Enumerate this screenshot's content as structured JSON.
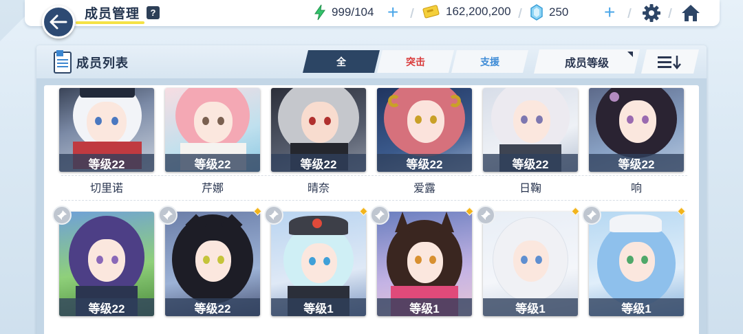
{
  "header": {
    "title": "成员管理",
    "help_label": "?",
    "stamina": "999/104",
    "gold": "162,200,200",
    "gems": "250"
  },
  "panel": {
    "title": "成员列表",
    "tabs": [
      {
        "label": "全",
        "active": true
      },
      {
        "label": "突击",
        "active": false
      },
      {
        "label": "支援",
        "active": false
      }
    ],
    "sort_label": "成员等级"
  },
  "members_row1": [
    {
      "level": "等级22",
      "name": "切里诺"
    },
    {
      "level": "等级22",
      "name": "芹娜"
    },
    {
      "level": "等级22",
      "name": "晴奈"
    },
    {
      "level": "等级22",
      "name": "爱露"
    },
    {
      "level": "等级22",
      "name": "日鞠"
    },
    {
      "level": "等级22",
      "name": "响"
    }
  ],
  "members_row2": [
    {
      "level": "等级22"
    },
    {
      "level": "等级22"
    },
    {
      "level": "等级1"
    },
    {
      "level": "等级1"
    },
    {
      "level": "等级1"
    },
    {
      "level": "等级1"
    }
  ],
  "colors": {
    "accent_dark": "#2c4564",
    "assault_red": "#d93a3a",
    "support_blue": "#3d8bd6",
    "new_dot": "#f2b41c",
    "title_underline": "#f4e246"
  },
  "icons": {
    "back": "arrow-left-icon",
    "stamina": "lightning-icon",
    "gold": "ticket-icon",
    "gems": "crystal-icon",
    "settings": "gear-icon",
    "home": "home-icon",
    "list": "clipboard-icon",
    "order": "sort-lines-arrow-icon",
    "pin": "pin-icon"
  }
}
